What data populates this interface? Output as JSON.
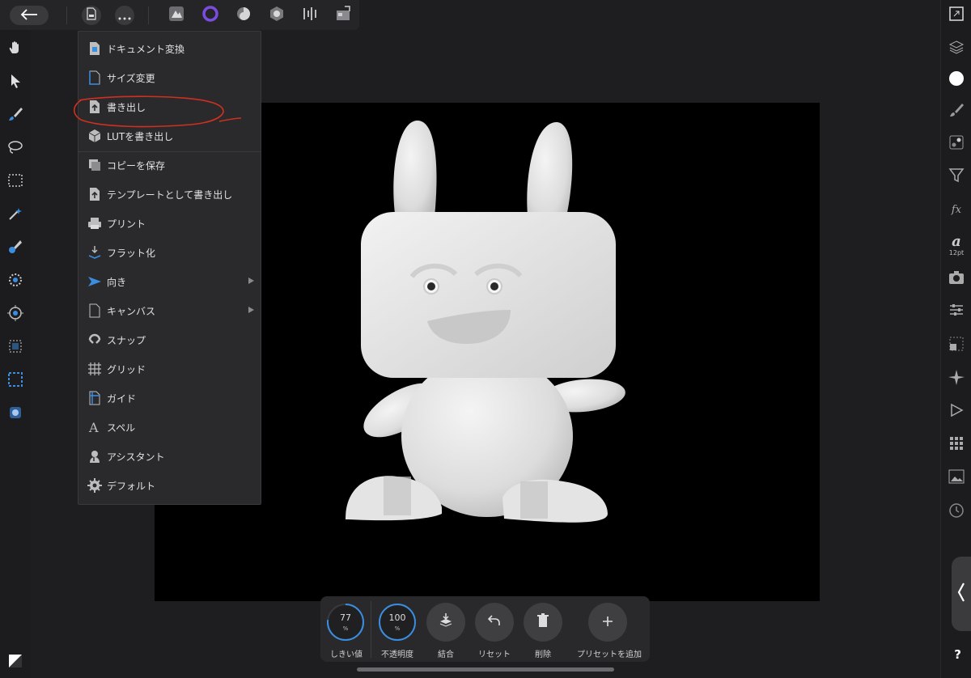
{
  "topbar": {
    "back_icon": "arrow-left-icon",
    "document_icon": "document-icon",
    "more_icon": "more-icon",
    "personas": [
      "photo-persona-icon",
      "liquify-persona-icon",
      "develop-persona-icon",
      "tone-mapping-persona-icon",
      "export-persona-icon",
      "layout-persona-icon"
    ]
  },
  "document_menu": {
    "items": [
      {
        "label": "ドキュメント変換",
        "icon": "convert-document-icon"
      },
      {
        "label": "サイズ変更",
        "icon": "resize-icon"
      },
      {
        "label": "書き出し",
        "icon": "export-icon"
      },
      {
        "label": "LUTを書き出し",
        "icon": "cube-icon"
      },
      {
        "label": "コピーを保存",
        "icon": "copy-icon"
      },
      {
        "label": "テンプレートとして書き出し",
        "icon": "template-export-icon"
      },
      {
        "label": "プリント",
        "icon": "printer-icon"
      },
      {
        "label": "フラット化",
        "icon": "flatten-icon"
      },
      {
        "label": "向き",
        "icon": "orientation-icon"
      },
      {
        "label": "キャンバス",
        "icon": "canvas-icon"
      },
      {
        "label": "スナップ",
        "icon": "magnet-icon"
      },
      {
        "label": "グリッド",
        "icon": "grid-icon"
      },
      {
        "label": "ガイド",
        "icon": "guides-icon"
      },
      {
        "label": "スペル",
        "icon": "spelling-icon"
      },
      {
        "label": "アシスタント",
        "icon": "assistant-icon"
      },
      {
        "label": "デフォルト",
        "icon": "gear-icon"
      }
    ]
  },
  "right_toolbar": {
    "text_size": "12pt"
  },
  "bottom_panel": {
    "threshold": {
      "value": "77",
      "unit": "%",
      "label": "しきい値",
      "fraction": 0.77
    },
    "opacity": {
      "value": "100",
      "unit": "%",
      "label": "不透明度",
      "fraction": 1.0
    },
    "merge_label": "結合",
    "reset_label": "リセット",
    "delete_label": "削除",
    "add_preset_label": "プリセットを追加"
  },
  "help_label": "?",
  "annotation_color": "#d0301f",
  "accent_color": "#3b8de0"
}
